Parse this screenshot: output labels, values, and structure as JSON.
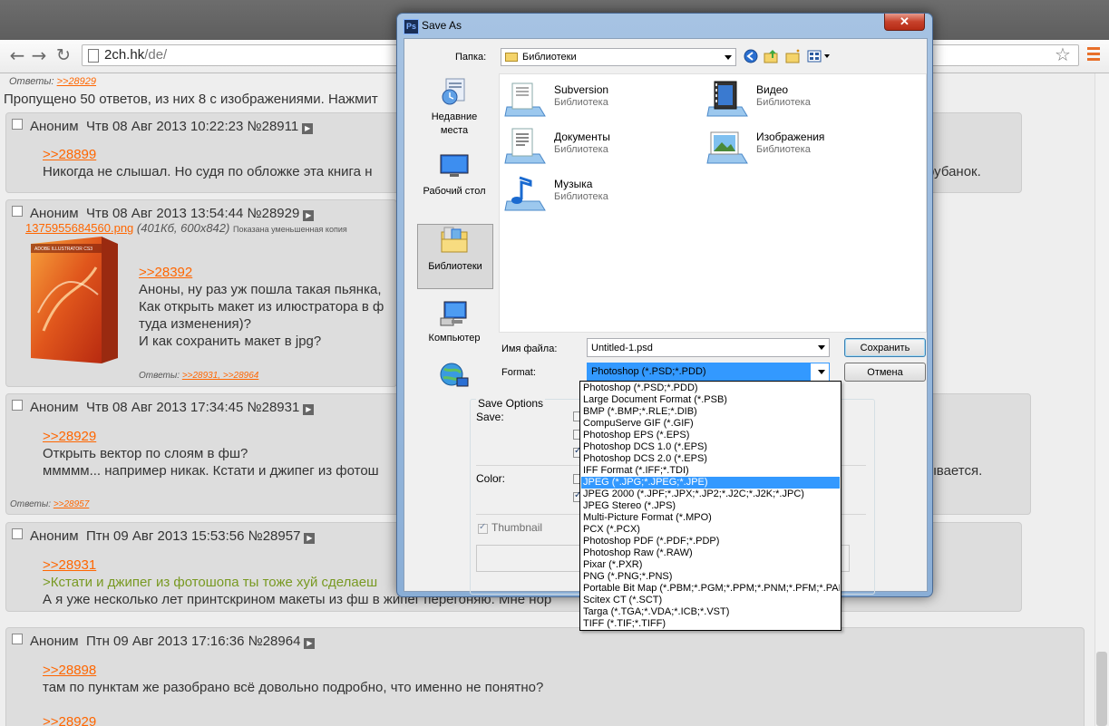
{
  "browser": {
    "url_host": "2ch.hk",
    "url_path": "/de/"
  },
  "page": {
    "top_replies_label": "Ответы:",
    "top_replies_link": ">>28929",
    "skipped_text": "Пропущено 50 ответов, из них 8 с изображениями. Нажмит",
    "posts": [
      {
        "name": "Аноним",
        "date": "Чтв 08 Авг 2013 10:22:23",
        "num": "№28911",
        "lines": [
          {
            "type": "link",
            "text": ">>28899"
          },
          {
            "type": "text",
            "text": "Никогда не слышал. Но судя по обложке эта книга н"
          }
        ],
        "tail_text": "рубанок."
      },
      {
        "name": "Аноним",
        "date": "Чтв 08 Авг 2013 13:54:44",
        "num": "№28929",
        "file_name": "1375955684560.png",
        "file_meta": "(401Кб, 600x842)",
        "file_note": "Показана уменьшенная копия",
        "cover_title": "ADOBE ILLUSTRATOR CS3",
        "lines": [
          {
            "type": "link",
            "text": ">>28392"
          },
          {
            "type": "text",
            "text": "Аноны, ну раз уж пошла такая пьянка,"
          },
          {
            "type": "text",
            "text": "Как открыть макет из илюстратора в ф"
          },
          {
            "type": "text",
            "text": "туда изменения)?"
          },
          {
            "type": "text",
            "text": "И как сохранить макет в jpg?"
          }
        ],
        "replies_label": "Ответы:",
        "replies": ">>28931, >>28964"
      },
      {
        "name": "Аноним",
        "date": "Чтв 08 Авг 2013 17:34:45",
        "num": "№28931",
        "lines": [
          {
            "type": "link",
            "text": ">>28929"
          },
          {
            "type": "text",
            "text": "Открыть вектор по слоям в фш?"
          },
          {
            "type": "text",
            "text": "ммммм... например никак. Кстати и джипег из фотош"
          }
        ],
        "tail_text": "ывается.",
        "replies_label": "Ответы:",
        "replies": ">>28957"
      },
      {
        "name": "Аноним",
        "date": "Птн 09 Авг 2013 15:53:56",
        "num": "№28957",
        "lines": [
          {
            "type": "link",
            "text": ">>28931"
          },
          {
            "type": "quote",
            "text": ">Кстати и джипег из фотошопа ты тоже хуй сделаеш"
          },
          {
            "type": "text",
            "text": "А я уже несколько лет принтскрином макеты из фш в жипег перегоняю. Мне нор"
          }
        ]
      },
      {
        "name": "Аноним",
        "date": "Птн 09 Авг 2013 17:16:36",
        "num": "№28964",
        "lines": [
          {
            "type": "link",
            "text": ">>28898"
          },
          {
            "type": "text",
            "text": "там по пунктам же разобрано всё довольно подробно, что именно не понятно?"
          },
          {
            "type": "blank",
            "text": ""
          },
          {
            "type": "link",
            "text": ">>28929"
          }
        ]
      }
    ]
  },
  "dialog": {
    "title": "Save As",
    "app_icon": "Ps",
    "close_label": "✕",
    "folder_label": "Папка:",
    "folder_value": "Библиотеки",
    "places": [
      {
        "label": "Недавние места",
        "icon": "recent-places-icon"
      },
      {
        "label": "Рабочий стол",
        "icon": "desktop-icon"
      },
      {
        "label": "Библиотеки",
        "icon": "libraries-icon",
        "selected": true
      },
      {
        "label": "Компьютер",
        "icon": "computer-icon"
      },
      {
        "label": "",
        "icon": "network-icon"
      }
    ],
    "libraries": [
      {
        "name": "Subversion",
        "type": "Библиотека"
      },
      {
        "name": "Видео",
        "type": "Библиотека"
      },
      {
        "name": "Документы",
        "type": "Библиотека"
      },
      {
        "name": "Изображения",
        "type": "Библиотека"
      },
      {
        "name": "Музыка",
        "type": "Библиотека"
      }
    ],
    "filename_label": "Имя файла:",
    "filename_value": "Untitled-1.psd",
    "format_label": "Format:",
    "format_value": "Photoshop (*.PSD;*.PDD)",
    "save_button": "Сохранить",
    "cancel_button": "Отмена",
    "save_options_title": "Save Options",
    "save_label": "Save:",
    "color_label": "Color:",
    "thumbnail_label": "Thumbnail",
    "format_options": [
      "Photoshop (*.PSD;*.PDD)",
      "Large Document Format (*.PSB)",
      "BMP (*.BMP;*.RLE;*.DIB)",
      "CompuServe GIF (*.GIF)",
      "Photoshop EPS (*.EPS)",
      "Photoshop DCS 1.0 (*.EPS)",
      "Photoshop DCS 2.0 (*.EPS)",
      "IFF Format (*.IFF;*.TDI)",
      "JPEG (*.JPG;*.JPEG;*.JPE)",
      "JPEG 2000 (*.JPF;*.JPX;*.JP2;*.J2C;*.J2K;*.JPC)",
      "JPEG Stereo (*.JPS)",
      "Multi-Picture Format (*.MPO)",
      "PCX (*.PCX)",
      "Photoshop PDF (*.PDF;*.PDP)",
      "Photoshop Raw (*.RAW)",
      "Pixar (*.PXR)",
      "PNG (*.PNG;*.PNS)",
      "Portable Bit Map (*.PBM;*.PGM;*.PPM;*.PNM;*.PFM;*.PAM)",
      "Scitex CT (*.SCT)",
      "Targa (*.TGA;*.VDA;*.ICB;*.VST)",
      "TIFF (*.TIF;*.TIFF)"
    ],
    "highlighted_option": "JPEG (*.JPG;*.JPEG;*.JPE)"
  },
  "colors": {
    "link": "#ff6600",
    "quote": "#789922",
    "highlight": "#3399ff"
  }
}
